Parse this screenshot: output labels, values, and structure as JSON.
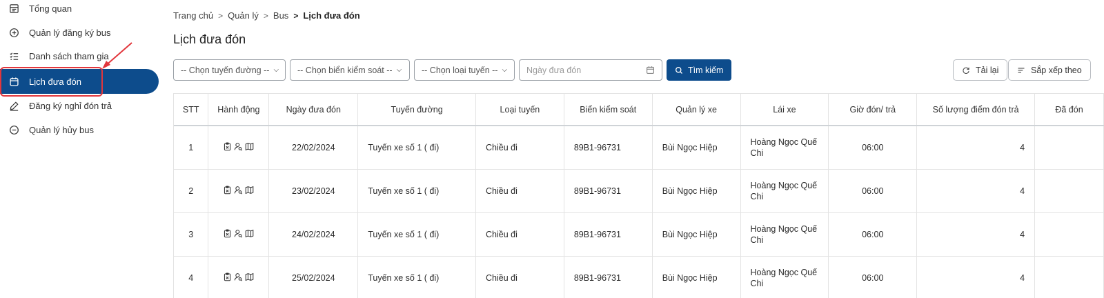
{
  "sidebar": {
    "items": [
      {
        "label": "Tổng quan",
        "icon": "dashboard-icon"
      },
      {
        "label": "Quản lý đăng ký bus",
        "icon": "plus-circle-icon"
      },
      {
        "label": "Danh sách tham gia",
        "icon": "checklist-icon"
      },
      {
        "label": "Lịch đưa đón",
        "icon": "calendar-icon",
        "active": true
      },
      {
        "label": "Đăng ký nghỉ đón trả",
        "icon": "pencil-icon"
      },
      {
        "label": "Quản lý hủy bus",
        "icon": "minus-circle-icon"
      }
    ]
  },
  "breadcrumb": [
    "Trang chủ",
    "Quản lý",
    "Bus",
    "Lịch đưa đón"
  ],
  "page_title": "Lịch đưa đón",
  "filters": {
    "route": "-- Chọn tuyến đường --",
    "plate": "-- Chọn biển kiểm soát --",
    "route_type": "-- Chọn loại tuyến --",
    "date_placeholder": "Ngày đưa đón",
    "search_label": "Tìm kiếm"
  },
  "toolbar": {
    "reload_label": "Tải lại",
    "sort_label": "Sắp xếp theo"
  },
  "table": {
    "headers": [
      "STT",
      "Hành động",
      "Ngày đưa đón",
      "Tuyến đường",
      "Loại tuyến",
      "Biển kiểm soát",
      "Quản lý xe",
      "Lái xe",
      "Giờ đón/ trả",
      "Số lượng điểm đón trả",
      "Đã đón"
    ],
    "rows": [
      {
        "stt": "1",
        "date": "22/02/2024",
        "route": "Tuyến xe số 1 ( đi)",
        "type": "Chiều đi",
        "plate": "89B1-96731",
        "manager": "Bùi Ngọc Hiệp",
        "driver_1": "Hoàng Ngọc Quế",
        "driver_2": "Chi",
        "time": "06:00",
        "points": "4"
      },
      {
        "stt": "2",
        "date": "23/02/2024",
        "route": "Tuyến xe số 1 ( đi)",
        "type": "Chiều đi",
        "plate": "89B1-96731",
        "manager": "Bùi Ngọc Hiệp",
        "driver_1": "Hoàng Ngọc Quế",
        "driver_2": "Chi",
        "time": "06:00",
        "points": "4"
      },
      {
        "stt": "3",
        "date": "24/02/2024",
        "route": "Tuyến xe số 1 ( đi)",
        "type": "Chiều đi",
        "plate": "89B1-96731",
        "manager": "Bùi Ngọc Hiệp",
        "driver_1": "Hoàng Ngọc Quế",
        "driver_2": "Chi",
        "time": "06:00",
        "points": "4"
      },
      {
        "stt": "4",
        "date": "25/02/2024",
        "route": "Tuyến xe số 1 ( đi)",
        "type": "Chiều đi",
        "plate": "89B1-96731",
        "manager": "Bùi Ngọc Hiệp",
        "driver_1": "Hoàng Ngọc Quế",
        "driver_2": "Chi",
        "time": "06:00",
        "points": "4"
      }
    ]
  },
  "colors": {
    "primary": "#0d4c8c",
    "highlight": "#e2363c"
  }
}
